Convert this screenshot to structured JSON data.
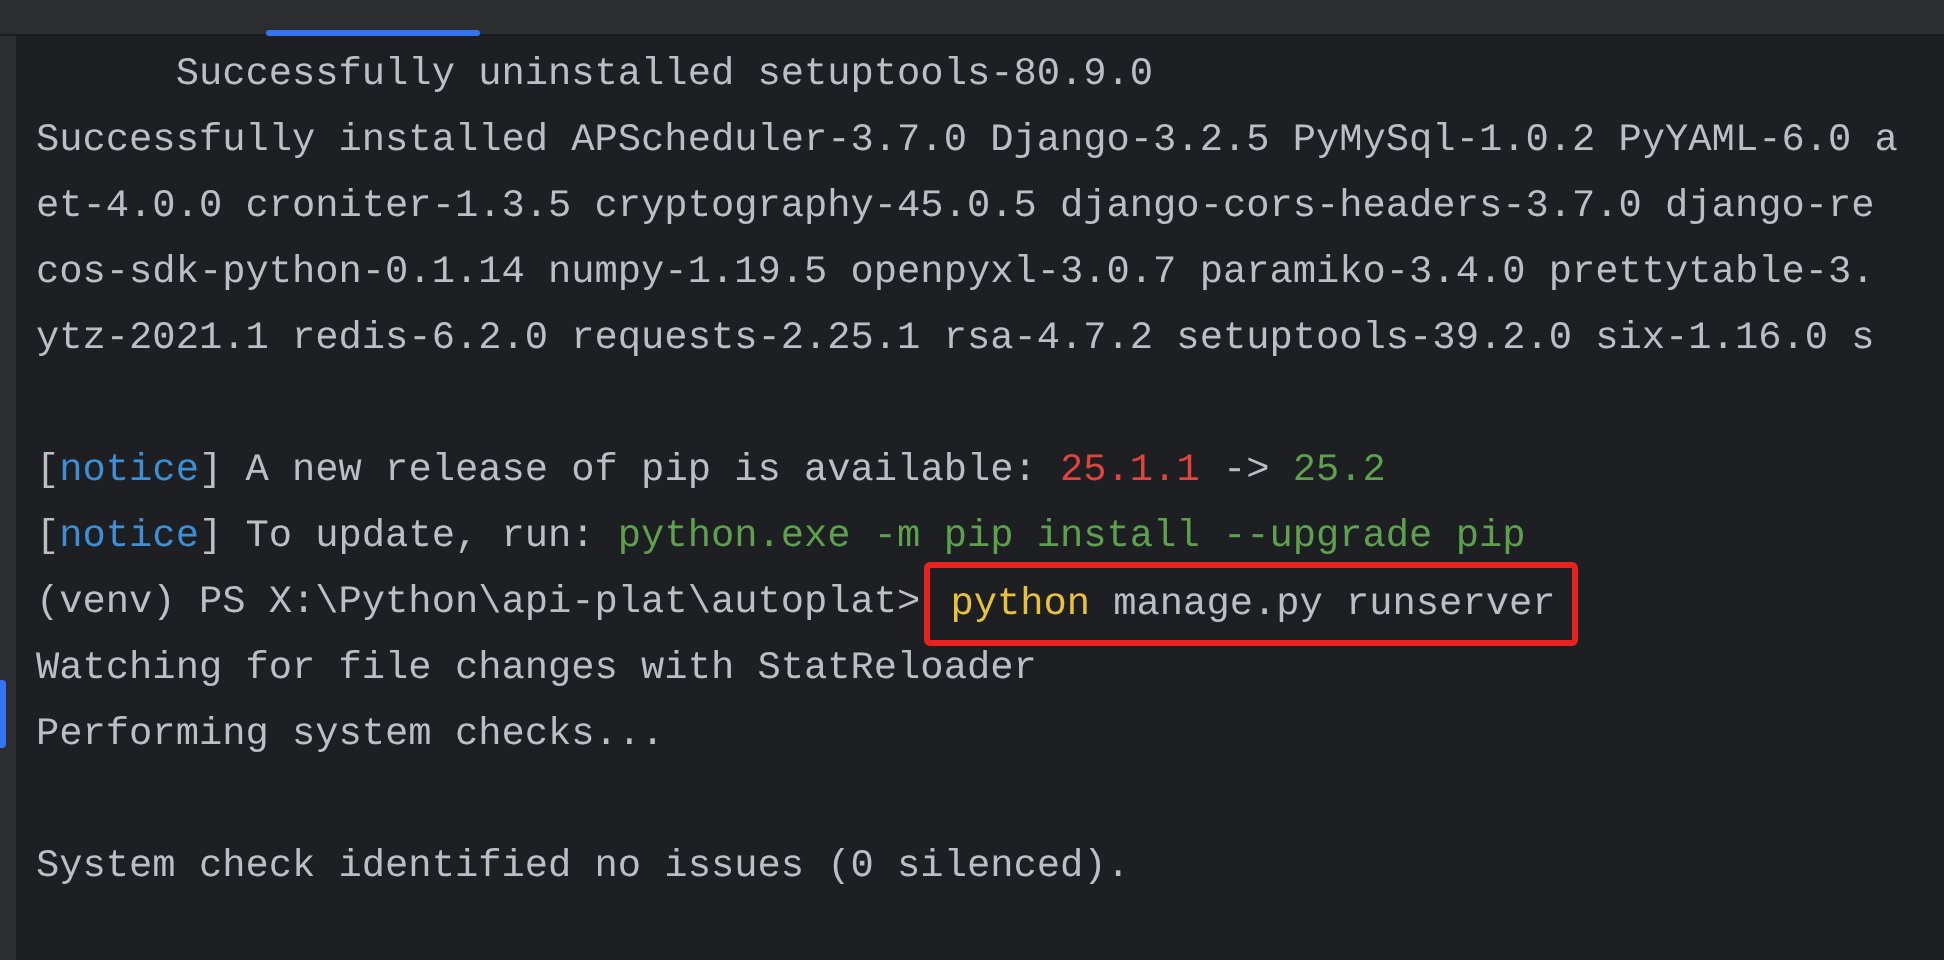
{
  "terminal": {
    "lines": [
      {
        "kind": "text",
        "segments": [
          {
            "kind": "plain",
            "text": "      Successfully uninstalled setuptools-80.9.0"
          }
        ]
      },
      {
        "kind": "text",
        "segments": [
          {
            "kind": "plain",
            "text": "Successfully installed APScheduler-3.7.0 Django-3.2.5 PyMySql-1.0.2 PyYAML-6.0 a"
          }
        ]
      },
      {
        "kind": "text",
        "segments": [
          {
            "kind": "plain",
            "text": "et-4.0.0 croniter-1.3.5 cryptography-45.0.5 django-cors-headers-3.7.0 django-re"
          }
        ]
      },
      {
        "kind": "text",
        "segments": [
          {
            "kind": "plain",
            "text": "cos-sdk-python-0.1.14 numpy-1.19.5 openpyxl-3.0.7 paramiko-3.4.0 prettytable-3."
          }
        ]
      },
      {
        "kind": "text",
        "segments": [
          {
            "kind": "plain",
            "text": "ytz-2021.1 redis-6.2.0 requests-2.25.1 rsa-4.7.2 setuptools-39.2.0 six-1.16.0 s"
          }
        ]
      },
      {
        "kind": "blank"
      },
      {
        "kind": "text",
        "segments": [
          {
            "kind": "plain",
            "text": "["
          },
          {
            "kind": "notice",
            "text": "notice"
          },
          {
            "kind": "plain",
            "text": "] A new release of pip is available: "
          },
          {
            "kind": "old-version",
            "text": "25.1.1"
          },
          {
            "kind": "plain",
            "text": " -> "
          },
          {
            "kind": "new-version",
            "text": "25.2"
          }
        ]
      },
      {
        "kind": "text",
        "segments": [
          {
            "kind": "plain",
            "text": "["
          },
          {
            "kind": "notice",
            "text": "notice"
          },
          {
            "kind": "plain",
            "text": "] To update, run: "
          },
          {
            "kind": "command",
            "text": "python.exe -m pip install --upgrade pip"
          }
        ]
      },
      {
        "kind": "text",
        "segments": [
          {
            "kind": "plain",
            "text": "(venv) PS X:\\Python\\api-plat\\autoplat>"
          }
        ],
        "boxed": [
          {
            "kind": "keyword",
            "text": "python"
          },
          {
            "kind": "plain",
            "text": " manage.py runserver"
          }
        ]
      },
      {
        "kind": "text",
        "segments": [
          {
            "kind": "plain",
            "text": "Watching for file changes with StatReloader"
          }
        ]
      },
      {
        "kind": "text",
        "segments": [
          {
            "kind": "plain",
            "text": "Performing system checks..."
          }
        ]
      },
      {
        "kind": "blank"
      },
      {
        "kind": "text",
        "segments": [
          {
            "kind": "plain",
            "text": "System check identified no issues (0 silenced)."
          }
        ]
      }
    ]
  }
}
